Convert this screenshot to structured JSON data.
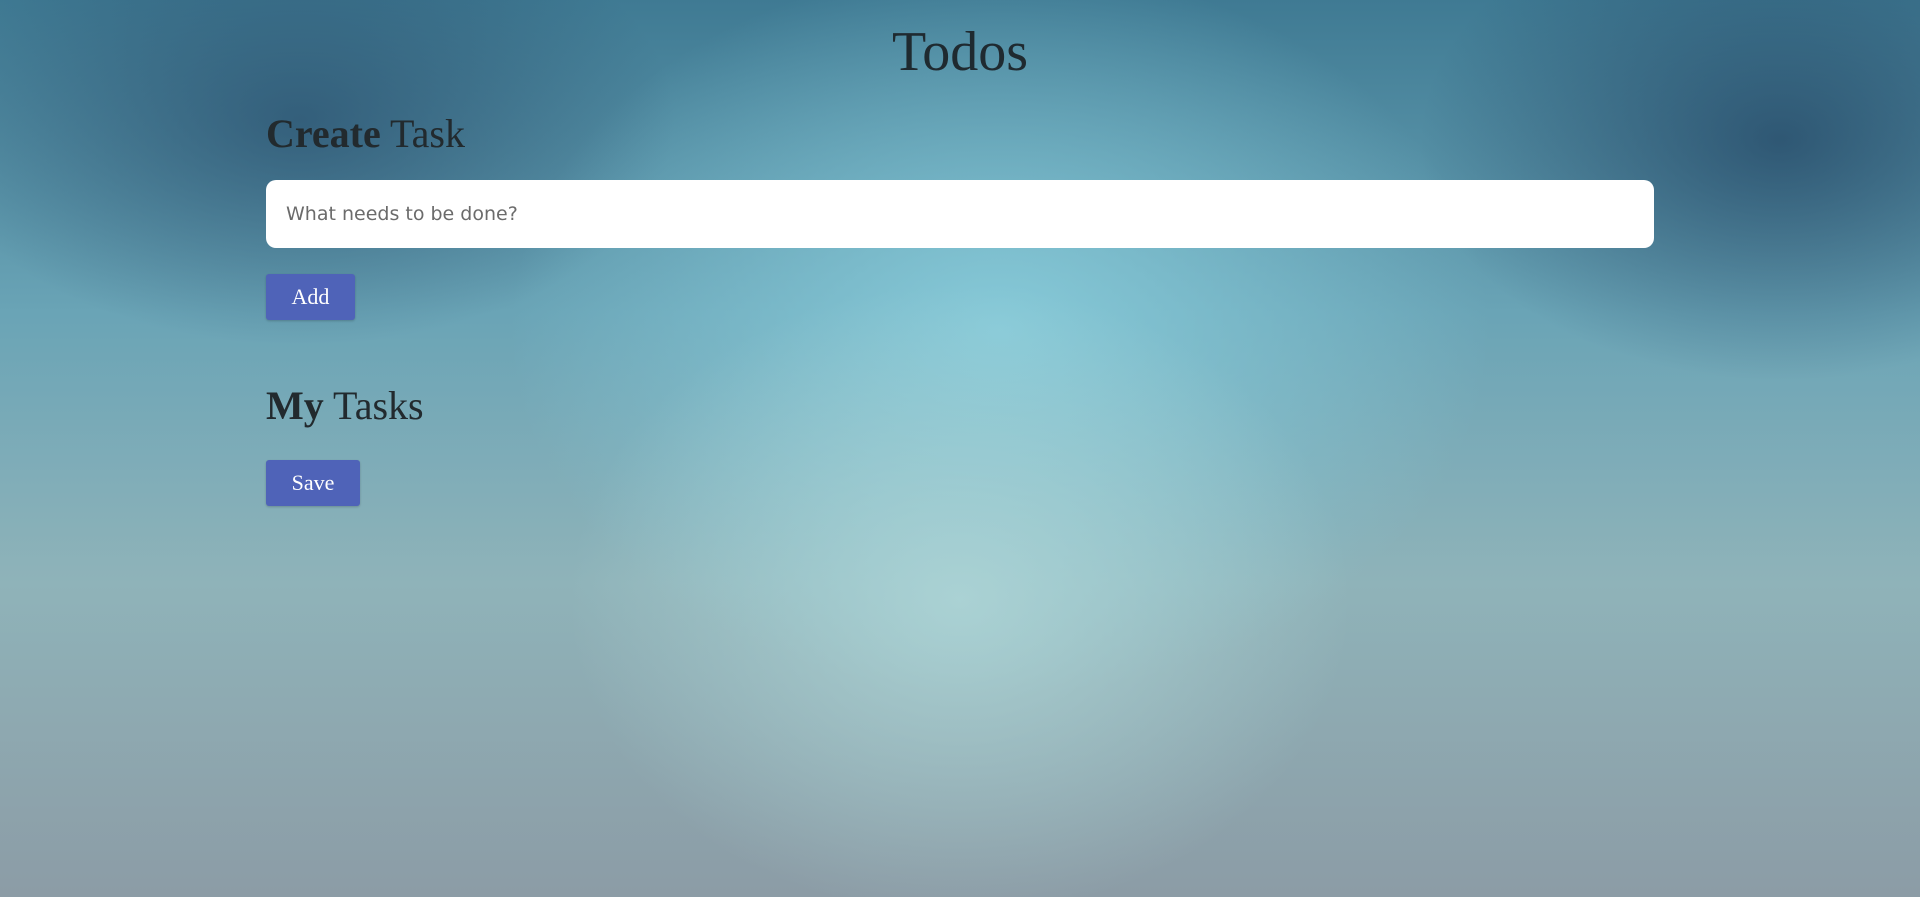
{
  "app": {
    "title": "Todos"
  },
  "create_section": {
    "heading_bold": "Create",
    "heading_rest": "Task",
    "input_placeholder": "What needs to be done?",
    "input_value": "",
    "add_label": "Add"
  },
  "tasks_section": {
    "heading_bold": "My",
    "heading_rest": "Tasks",
    "tasks": [],
    "save_label": "Save"
  },
  "colors": {
    "button_bg": "#4f63b8",
    "button_text": "#ffffff",
    "heading_text": "#222a2e",
    "input_bg": "#ffffff"
  }
}
